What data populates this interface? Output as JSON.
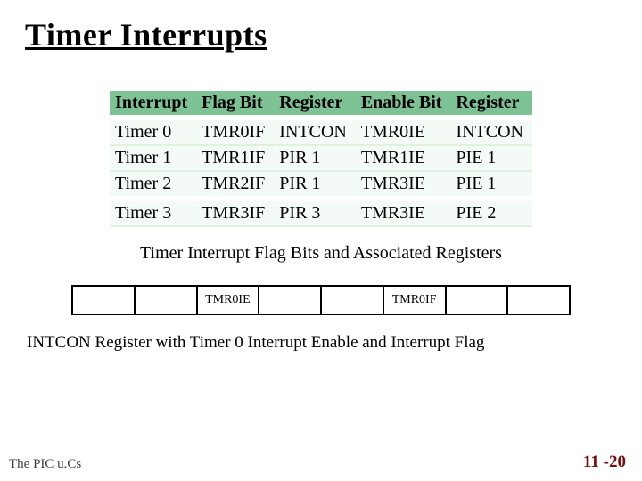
{
  "title": "Timer Interrupts",
  "headers": [
    "Interrupt",
    "Flag Bit",
    "Register",
    "Enable Bit",
    "Register"
  ],
  "rows": [
    {
      "c0": "Timer 0",
      "c1": "TMR0IF",
      "c2": "INTCON",
      "c3": "TMR0IE",
      "c4": "INTCON"
    },
    {
      "c0": "Timer 1",
      "c1": "TMR1IF",
      "c2": "PIR 1",
      "c3": "TMR1IE",
      "c4": "PIE 1"
    },
    {
      "c0": "Timer 2",
      "c1": "TMR2IF",
      "c2": "PIR 1",
      "c3": "TMR3IE",
      "c4": "PIE 1"
    },
    {
      "c0": "Timer 3",
      "c1": "TMR3IF",
      "c2": "PIR 3",
      "c3": "TMR3IE",
      "c4": "PIE 2"
    }
  ],
  "caption": "Timer Interrupt Flag Bits and Associated Registers",
  "reg_bits": [
    "",
    "",
    "TMR0IE",
    "",
    "",
    "TMR0IF",
    "",
    ""
  ],
  "reg_caption": "INTCON Register with Timer 0 Interrupt Enable and Interrupt Flag",
  "footer_left": "The PIC u.Cs",
  "footer_right": "11 -20",
  "chart_data": {
    "type": "table",
    "title": "Timer Interrupt Flag Bits and Associated Registers",
    "columns": [
      "Interrupt",
      "Flag Bit",
      "Flag Register",
      "Enable Bit",
      "Enable Register"
    ],
    "rows": [
      [
        "Timer 0",
        "TMR0IF",
        "INTCON",
        "TMR0IE",
        "INTCON"
      ],
      [
        "Timer 1",
        "TMR1IF",
        "PIR1",
        "TMR1IE",
        "PIE1"
      ],
      [
        "Timer 2",
        "TMR2IF",
        "PIR1",
        "TMR3IE",
        "PIE1"
      ],
      [
        "Timer 3",
        "TMR3IF",
        "PIR3",
        "TMR3IE",
        "PIE2"
      ]
    ]
  }
}
